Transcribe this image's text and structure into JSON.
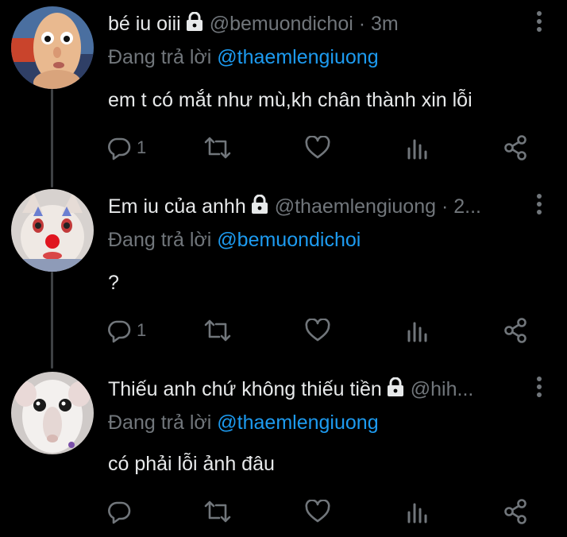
{
  "tweets": [
    {
      "name": "bé iu oiii",
      "handle": "@bemuondichoi",
      "time": "3m",
      "reply_prefix": "Đang trả lời",
      "reply_to": "@thaemlengiuong",
      "text": "em t có mắt như mù,kh chân thành xin lỗi",
      "reply_count": "1",
      "avatar": "baby-avatar",
      "locked": true
    },
    {
      "name": "Em iu của anhh",
      "handle": "@thaemlengiuong",
      "time": "2...",
      "reply_prefix": "Đang trả lời",
      "reply_to": "@bemuondichoi",
      "text": "?",
      "reply_count": "1",
      "avatar": "cat-clown-avatar",
      "locked": true
    },
    {
      "name": "Thiếu anh chứ không thiếu tiền",
      "handle": "@hih...",
      "time": "",
      "reply_prefix": "Đang trả lời",
      "reply_to": "@thaemlengiuong",
      "text": "có phải lỗi ảnh đâu",
      "reply_count": "",
      "avatar": "mouse-avatar",
      "locked": true
    }
  ],
  "colors": {
    "background": "#000000",
    "text": "#e7e9ea",
    "muted": "#71767b",
    "mention": "#1d9bf0",
    "thread_line": "#3e4144"
  },
  "icons": {
    "reply": "reply-bubble-icon",
    "retweet": "retweet-icon",
    "like": "heart-icon",
    "views": "views-bar-icon",
    "share": "share-icon",
    "more": "more-dots-icon",
    "lock": "lock-icon"
  }
}
